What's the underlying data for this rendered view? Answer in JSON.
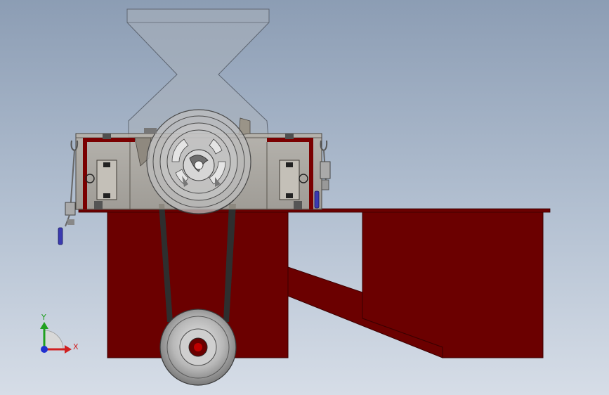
{
  "viewport": {
    "background_top": "#8c9db4",
    "background_bottom": "#d6dde7"
  },
  "colors": {
    "frame_red": "#6b0000",
    "frame_edge": "#3a0000",
    "housing_gray": "#aaa49a",
    "hopper_fill": "#a9b0ba",
    "pulley_gray": "#b4b4b4",
    "belt": "#2e2e2e",
    "handle_blue": "#3a3ab0"
  },
  "triad": {
    "x_label": "X",
    "y_label": "Y",
    "x_color": "#d02020",
    "y_color": "#20a020",
    "z_color": "#2030d0",
    "icon": "coordinate-triad-icon"
  }
}
